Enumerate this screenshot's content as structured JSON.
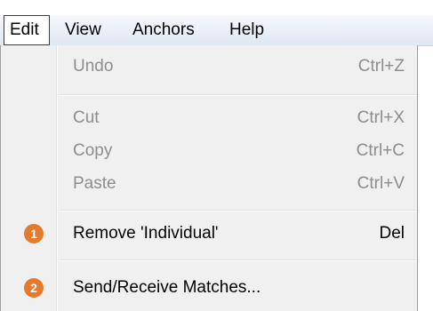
{
  "menubar": {
    "items": [
      {
        "label": "Edit"
      },
      {
        "label": "View"
      },
      {
        "label": "Anchors"
      },
      {
        "label": "Help"
      }
    ]
  },
  "edit_menu": {
    "undo": {
      "label": "Undo",
      "shortcut": "Ctrl+Z"
    },
    "cut": {
      "label": "Cut",
      "shortcut": "Ctrl+X"
    },
    "copy": {
      "label": "Copy",
      "shortcut": "Ctrl+C"
    },
    "paste": {
      "label": "Paste",
      "shortcut": "Ctrl+V"
    },
    "remove": {
      "label": "Remove 'Individual'",
      "shortcut": "Del",
      "badge": "1"
    },
    "send_receive": {
      "label": "Send/Receive Matches...",
      "badge": "2"
    }
  },
  "colors": {
    "badge": "#e57a2c",
    "disabled_text": "#8d8d8d",
    "menu_background": "#f0f0f0"
  }
}
